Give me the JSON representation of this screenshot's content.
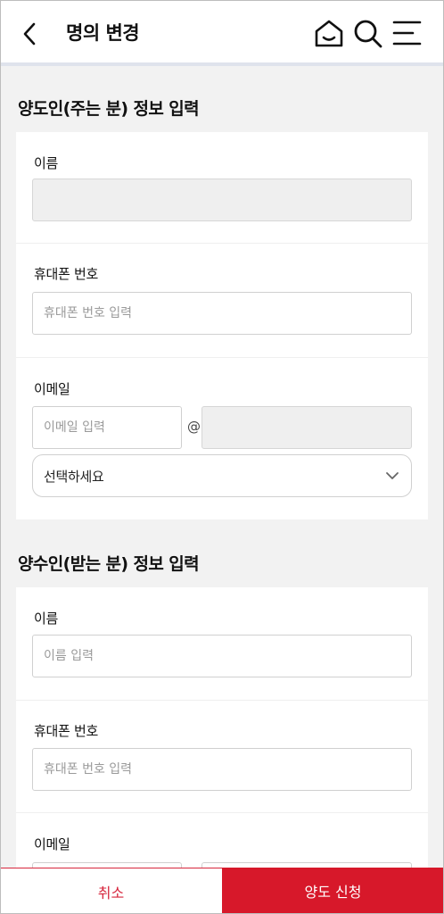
{
  "header": {
    "title": "명의 변경",
    "icons": [
      "back-arrow-icon",
      "home-icon",
      "search-icon",
      "menu-icon"
    ]
  },
  "giver": {
    "title": "양도인(주는 분) 정보 입력",
    "name_label": "이름",
    "name_value": "",
    "phone_label": "휴대폰 번호",
    "phone_placeholder": "휴대폰 번호 입력",
    "email_label": "이메일",
    "email_placeholder": "이메일 입력",
    "at_symbol": "@",
    "domain_value": "",
    "domain_select": "선택하세요"
  },
  "receiver": {
    "title": "양수인(받는 분) 정보 입력",
    "name_label": "이름",
    "name_placeholder": "이름 입력",
    "phone_label": "휴대폰 번호",
    "phone_placeholder": "휴대폰 번호 입력",
    "email_label": "이메일"
  },
  "footer": {
    "cancel_label": "취소",
    "submit_label": "양도 신청"
  },
  "colors": {
    "accent": "#d7182a",
    "page_bg": "#f2f2f2",
    "header_divider": "#dfe3ec"
  }
}
